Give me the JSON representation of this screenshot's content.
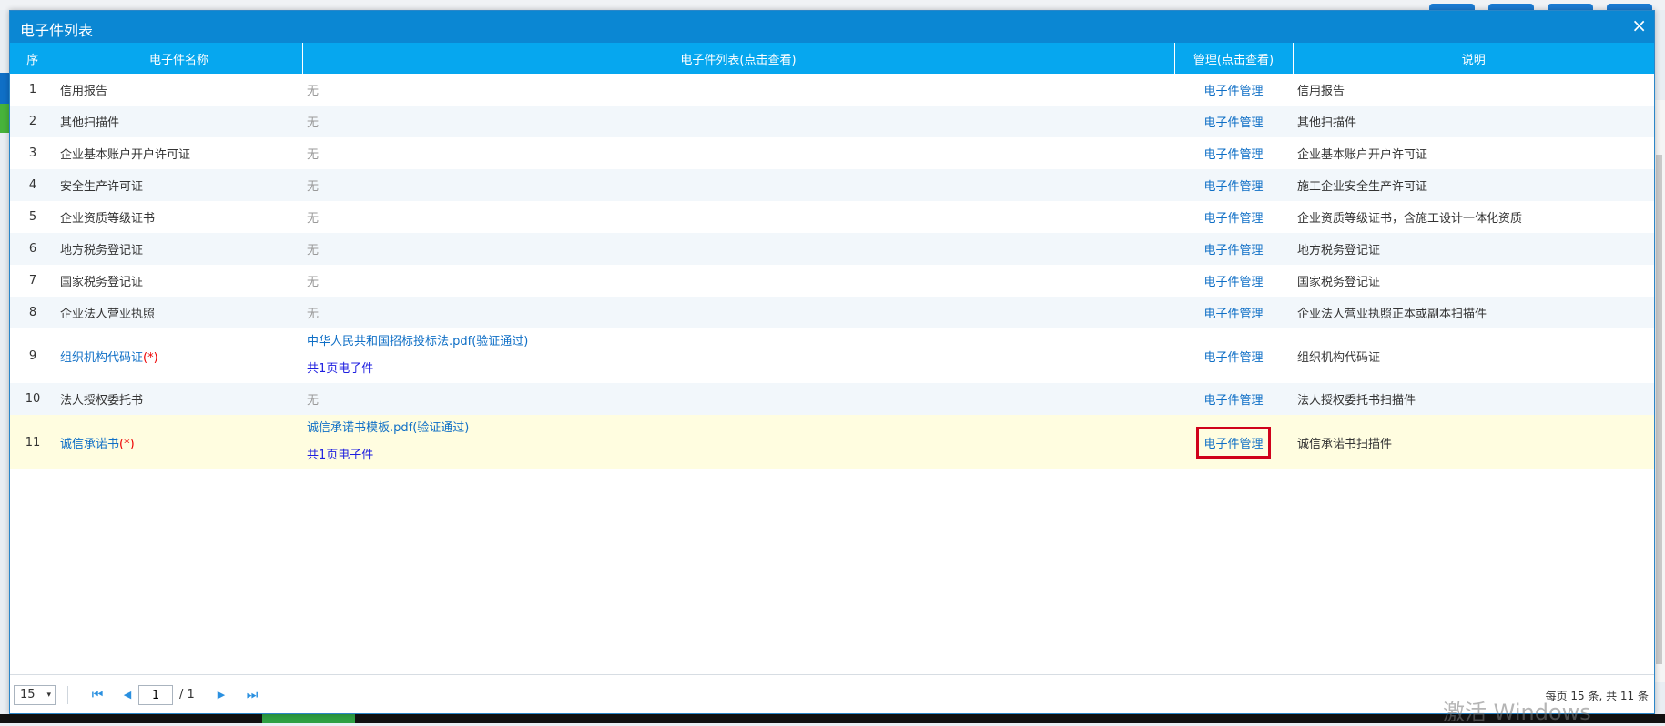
{
  "dialog": {
    "title": "电子件列表",
    "close_glyph": "×"
  },
  "table": {
    "headers": [
      "序",
      "电子件名称",
      "电子件列表(点击查看)",
      "管理(点击查看)",
      "说明"
    ],
    "rows": [
      {
        "idx": "1",
        "name": "信用报告",
        "list": "无",
        "mgmt": "电子件管理",
        "desc": "信用报告"
      },
      {
        "idx": "2",
        "name": "其他扫描件",
        "list": "无",
        "mgmt": "电子件管理",
        "desc": "其他扫描件"
      },
      {
        "idx": "3",
        "name": "企业基本账户开户许可证",
        "list": "无",
        "mgmt": "电子件管理",
        "desc": "企业基本账户开户许可证"
      },
      {
        "idx": "4",
        "name": "安全生产许可证",
        "list": "无",
        "mgmt": "电子件管理",
        "desc": "施工企业安全生产许可证"
      },
      {
        "idx": "5",
        "name": "企业资质等级证书",
        "list": "无",
        "mgmt": "电子件管理",
        "desc": "企业资质等级证书，含施工设计一体化资质"
      },
      {
        "idx": "6",
        "name": "地方税务登记证",
        "list": "无",
        "mgmt": "电子件管理",
        "desc": "地方税务登记证"
      },
      {
        "idx": "7",
        "name": "国家税务登记证",
        "list": "无",
        "mgmt": "电子件管理",
        "desc": "国家税务登记证"
      },
      {
        "idx": "8",
        "name": "企业法人营业执照",
        "list": "无",
        "mgmt": "电子件管理",
        "desc": "企业法人营业执照正本或副本扫描件"
      },
      {
        "idx": "9",
        "name": "组织机构代码证",
        "required": "(*)",
        "file": "中华人民共和国招标投标法.pdf(验证通过)",
        "pages": "共1页电子件",
        "mgmt": "电子件管理",
        "desc": "组织机构代码证"
      },
      {
        "idx": "10",
        "name": "法人授权委托书",
        "list": "无",
        "mgmt": "电子件管理",
        "desc": "法人授权委托书扫描件"
      },
      {
        "idx": "11",
        "name": "诚信承诺书",
        "required": "(*)",
        "file": "诚信承诺书模板.pdf(验证通过)",
        "pages": "共1页电子件",
        "mgmt": "电子件管理",
        "desc": "诚信承诺书扫描件"
      }
    ]
  },
  "pager": {
    "page_size": "15",
    "dropdown_glyph": "▾",
    "first_glyph": "⏮",
    "prev_glyph": "◀",
    "next_glyph": "▶",
    "last_glyph": "⏭",
    "current_page": "1",
    "total_pages": "/ 1",
    "info": "每页 15 条, 共 11 条"
  },
  "watermark": "激活 Windows"
}
